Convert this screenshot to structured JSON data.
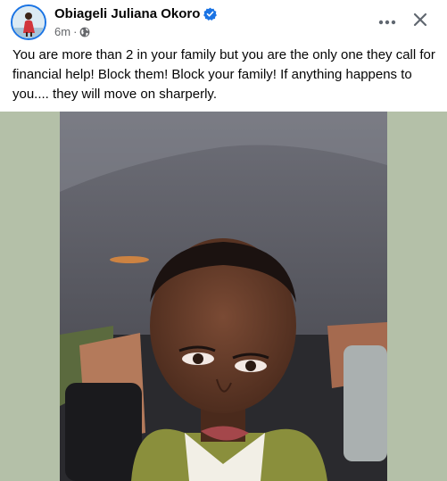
{
  "post": {
    "author_name": "Obiageli Juliana Okoro",
    "time": "6m",
    "separator": "·",
    "privacy_icon": "globe-icon",
    "verified_icon": "verified-badge-icon",
    "more_icon": "more-horizontal-icon",
    "close_icon": "close-icon",
    "body": "You are more than 2 in your family but you are the only one they call for financial help! Block them! Block your family! If anything happens to you.... they will move on sharperly."
  },
  "colors": {
    "accent": "#1b74e4",
    "secondary_text": "#65676b",
    "media_background": "#b4c0a8"
  }
}
